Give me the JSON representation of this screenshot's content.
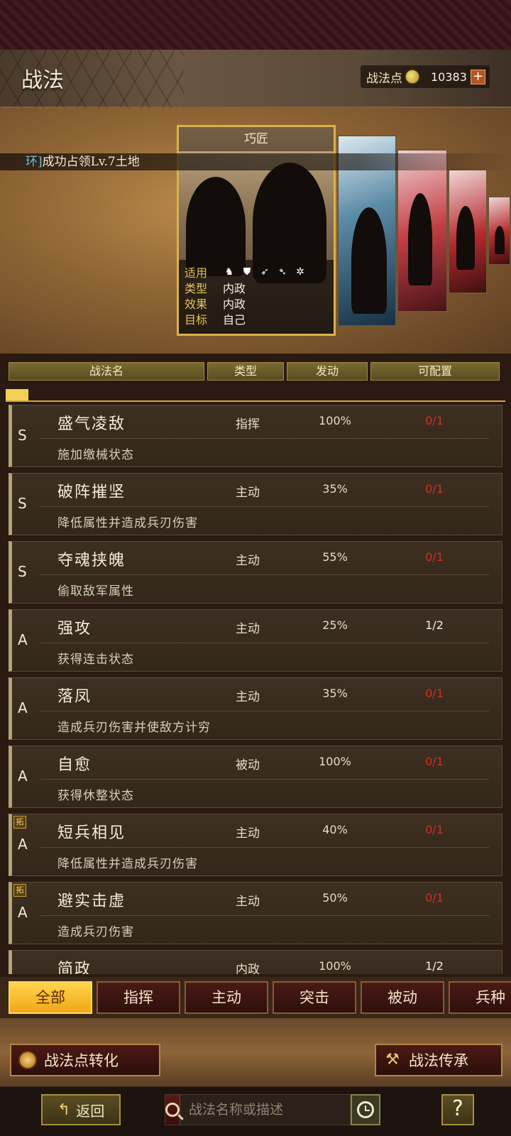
{
  "header": {
    "title": "战法",
    "points_label": "战法点",
    "points_value": "10383",
    "plus": "+"
  },
  "showcase": {
    "task_prefix": "环]",
    "task_text": "成功占领Lv.7土地",
    "card_title": "巧匠",
    "info": {
      "apply_label": "适用",
      "type_label": "类型",
      "type_value": "内政",
      "effect_label": "效果",
      "effect_value": "内政",
      "target_label": "目标",
      "target_value": "自己"
    },
    "unit_icons": [
      "cavalry-icon",
      "shield-icon",
      "bow-icon",
      "spear-icon",
      "wheel-icon"
    ]
  },
  "columns": {
    "name": "战法名",
    "type": "类型",
    "rate": "发动",
    "config": "可配置"
  },
  "skills": [
    {
      "grade": "S",
      "name": "盛气凌敌",
      "type": "指挥",
      "rate": "100%",
      "config": "0/1",
      "desc": "施加缴械状态",
      "red": true,
      "tuo": ""
    },
    {
      "grade": "S",
      "name": "破阵摧坚",
      "type": "主动",
      "rate": "35%",
      "config": "0/1",
      "desc": "降低属性并造成兵刃伤害",
      "red": true,
      "tuo": ""
    },
    {
      "grade": "S",
      "name": "夺魂挟魄",
      "type": "主动",
      "rate": "55%",
      "config": "0/1",
      "desc": "偷取敌军属性",
      "red": true,
      "tuo": ""
    },
    {
      "grade": "A",
      "name": "强攻",
      "type": "主动",
      "rate": "25%",
      "config": "1/2",
      "desc": "获得连击状态",
      "red": false,
      "tuo": ""
    },
    {
      "grade": "A",
      "name": "落凤",
      "type": "主动",
      "rate": "35%",
      "config": "0/1",
      "desc": "造成兵刃伤害并使敌方计穷",
      "red": true,
      "tuo": ""
    },
    {
      "grade": "A",
      "name": "自愈",
      "type": "被动",
      "rate": "100%",
      "config": "0/1",
      "desc": "获得休整状态",
      "red": true,
      "tuo": ""
    },
    {
      "grade": "A",
      "name": "短兵相见",
      "type": "主动",
      "rate": "40%",
      "config": "0/1",
      "desc": "降低属性并造成兵刃伤害",
      "red": true,
      "tuo": "拓"
    },
    {
      "grade": "A",
      "name": "避实击虚",
      "type": "主动",
      "rate": "50%",
      "config": "0/1",
      "desc": "造成兵刃伤害",
      "red": true,
      "tuo": "拓"
    },
    {
      "grade": "",
      "name": "简政",
      "type": "内政",
      "rate": "100%",
      "config": "1/2",
      "desc": "",
      "red": false,
      "tuo": ""
    }
  ],
  "filters": [
    "全部",
    "指挥",
    "主动",
    "突击",
    "被动",
    "兵种"
  ],
  "actions": {
    "convert": "战法点转化",
    "inherit": "战法传承"
  },
  "bottom": {
    "back": "返回",
    "search_placeholder": "战法名称或描述",
    "help": "?"
  }
}
